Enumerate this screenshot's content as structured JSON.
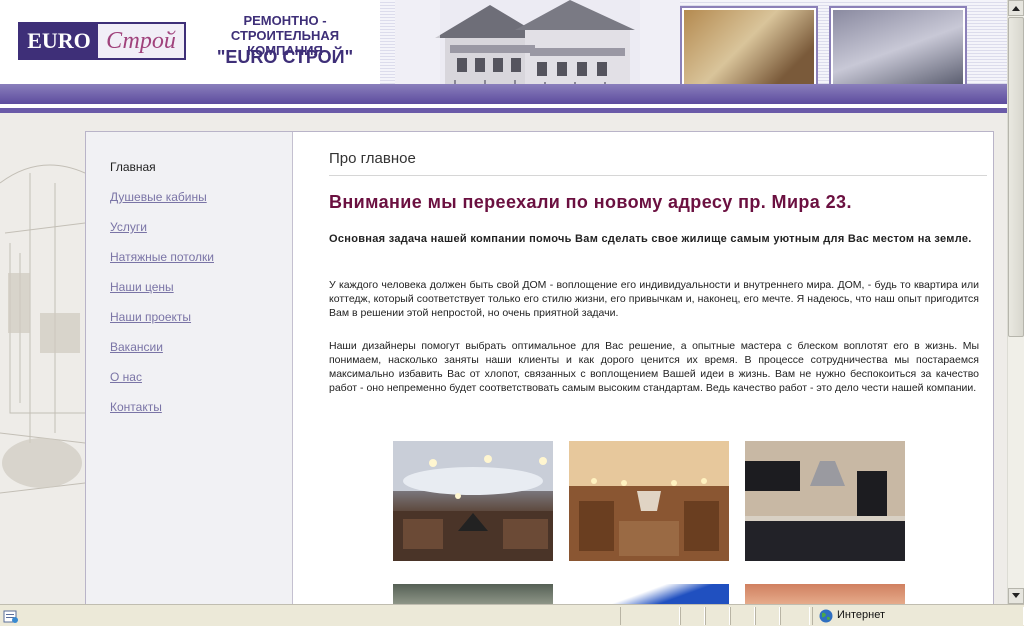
{
  "header": {
    "logo_euro": "EURO",
    "logo_stroy": "Строй",
    "company_line1": "РЕМОНТНО - СТРОИТЕЛЬНАЯ",
    "company_line2": "КОМПАНИЯ",
    "company_name": "\"EURO СТРОЙ\""
  },
  "nav": {
    "items": [
      {
        "label": "Главная",
        "active": true
      },
      {
        "label": "Душевые кабины"
      },
      {
        "label": "Услуги"
      },
      {
        "label": "Натяжные потолки"
      },
      {
        "label": "Наши цены"
      },
      {
        "label": "Наши проекты"
      },
      {
        "label": "Вакансии"
      },
      {
        "label": "О нас"
      },
      {
        "label": "Контакты"
      }
    ]
  },
  "main": {
    "title": "Про главное",
    "headline": "Внимание мы переехали по новому адресу пр. Мира 23.",
    "lead": "Основная задача нашей компании помочь Вам сделать свое жилище самым уютным для Вас местом на земле.",
    "para1": "У каждого человека должен быть свой ДОМ - воплощение его индивидуальности и внутреннего мира. ДОМ, - будь то квартира или коттедж, который соответствует только его стилю жизни, его привычкам и, наконец, его мечте. Я надеюсь, что наш опыт пригодится Вам в решении этой непростой, но очень приятной задачи.",
    "para2": "Наши дизайнеры помогут выбрать оптимальное для Вас решение, а опытные мастера с блеском воплотят его в жизнь. Мы понимаем, насколько заняты наши клиенты и как дорого ценится их время. В процессе сотрудничества мы постараемся максимально избавить Вас от хлопот, связанных с воплощением Вашей идеи в жизнь. Вам не нужно беспокоиться за качество работ - оно непременно будет соответствовать самым высоким стандартам. Ведь качество работ - это дело чести нашей компании."
  },
  "statusbar": {
    "zone_label": "Интернет"
  },
  "colors": {
    "brand_purple": "#3e2f78",
    "headline": "#6b1040",
    "nav_link": "#7a74a6"
  }
}
